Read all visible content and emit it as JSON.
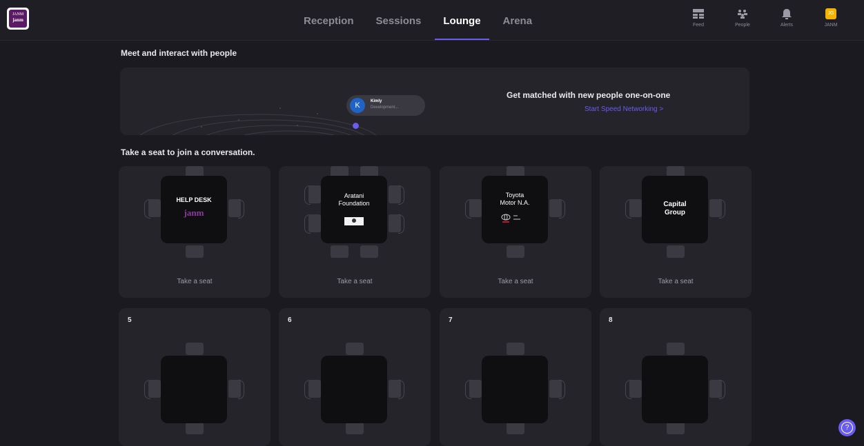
{
  "logo": {
    "line1": "JANM",
    "line2": "janm"
  },
  "tabs": [
    {
      "label": "Reception"
    },
    {
      "label": "Sessions"
    },
    {
      "label": "Lounge"
    },
    {
      "label": "Arena"
    }
  ],
  "active_tab": "Lounge",
  "nav": {
    "feed": "Feed",
    "people": "People",
    "alerts": "Alerts",
    "user_initials": "JG",
    "user": "JANM"
  },
  "meet_title": "Meet and interact with people",
  "banner": {
    "bubble_initial": "K",
    "bubble_name": "Kimly",
    "bubble_role": "Development...",
    "title": "Get matched with new people one-on-one",
    "link": "Start Speed Networking >"
  },
  "seat_title": "Take a seat to join a conversation.",
  "tables": [
    {
      "name": "HELP DESK",
      "logo": "janm",
      "action": "Take a seat"
    },
    {
      "name": "Aratani Foundation",
      "action": "Take a seat"
    },
    {
      "name": "Toyota Motor N.A.",
      "action": "Take a seat"
    },
    {
      "name": "Capital Group",
      "action": "Take a seat"
    },
    {
      "number": "5"
    },
    {
      "number": "6"
    },
    {
      "number": "7"
    },
    {
      "number": "8"
    }
  ],
  "help_label": "?",
  "colors": {
    "accent": "#6b5cf0",
    "background": "#1b1a20",
    "card": "#25242b",
    "table": "#0f0f12",
    "avatar": "#f3b300",
    "brand": "#5b1a66"
  }
}
